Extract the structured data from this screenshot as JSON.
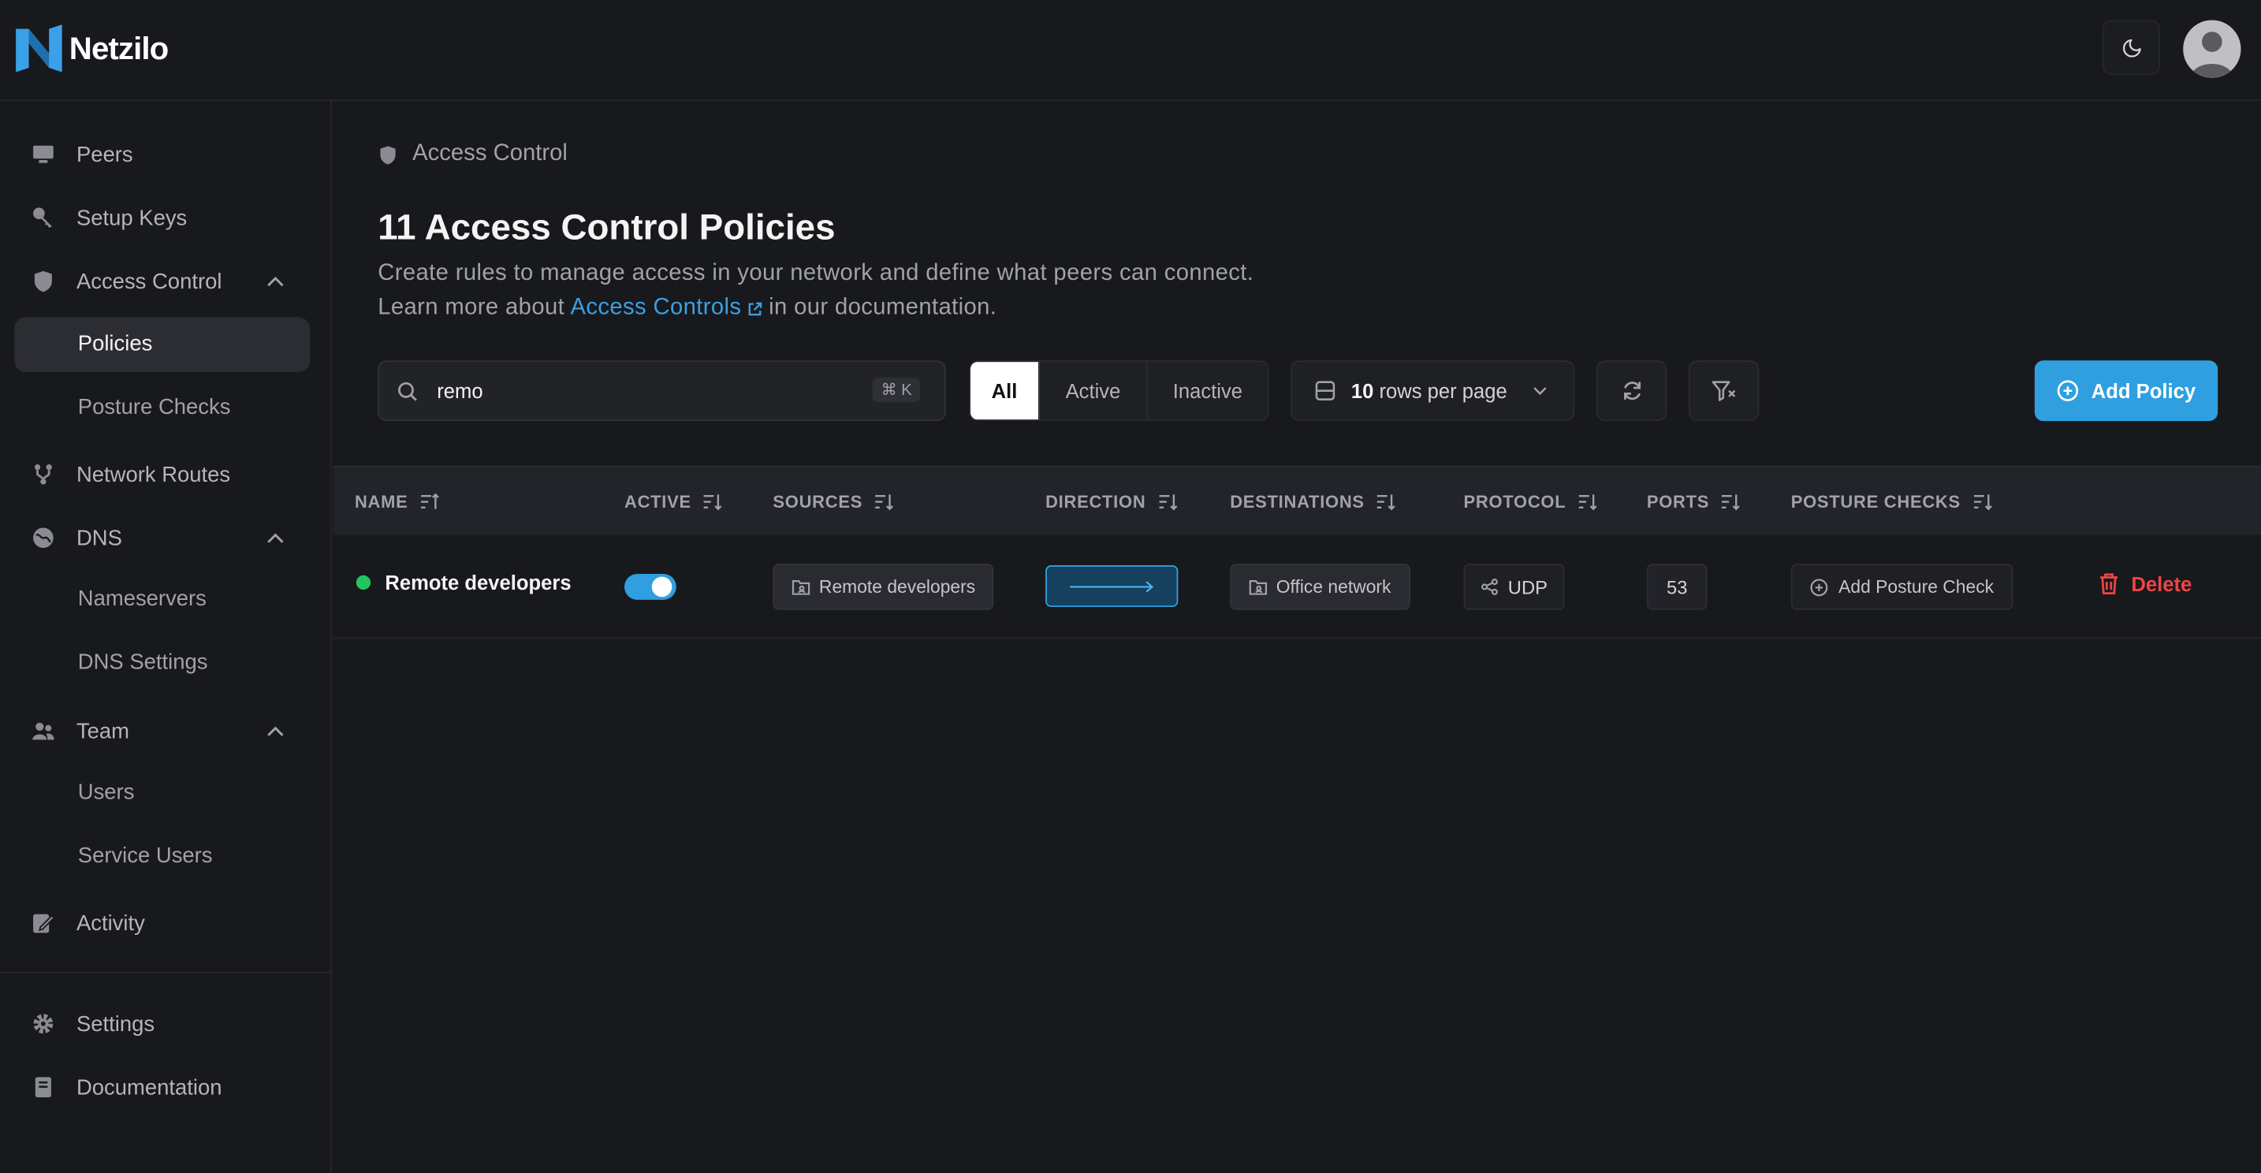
{
  "app": {
    "name": "Netzilo"
  },
  "sidebar": {
    "items": [
      {
        "label": "Peers"
      },
      {
        "label": "Setup Keys"
      },
      {
        "label": "Access Control"
      },
      {
        "label": "Policies"
      },
      {
        "label": "Posture Checks"
      },
      {
        "label": "Network Routes"
      },
      {
        "label": "DNS"
      },
      {
        "label": "Nameservers"
      },
      {
        "label": "DNS Settings"
      },
      {
        "label": "Team"
      },
      {
        "label": "Users"
      },
      {
        "label": "Service Users"
      },
      {
        "label": "Activity"
      },
      {
        "label": "Settings"
      },
      {
        "label": "Documentation"
      }
    ]
  },
  "breadcrumb": {
    "label": "Access Control"
  },
  "page": {
    "title": "11 Access Control Policies",
    "description_line1": "Create rules to manage access in your network and define what peers can connect.",
    "description_prefix": "Learn more about",
    "description_link": "Access Controls",
    "description_suffix": "in our documentation."
  },
  "search": {
    "value": "remo",
    "shortcut": "⌘ K"
  },
  "filters": {
    "all": "All",
    "active": "Active",
    "inactive": "Inactive",
    "selected": "All"
  },
  "pagination": {
    "rows_count": "10",
    "rows_label": "rows per page"
  },
  "actions": {
    "add_policy": "Add Policy"
  },
  "table": {
    "columns": [
      "NAME",
      "ACTIVE",
      "SOURCES",
      "DIRECTION",
      "DESTINATIONS",
      "PROTOCOL",
      "PORTS",
      "POSTURE CHECKS"
    ],
    "rows": [
      {
        "name": "Remote developers",
        "active": true,
        "source": "Remote developers",
        "direction": "→",
        "destination": "Office network",
        "protocol": "UDP",
        "ports": "53",
        "posture": "Add Posture Check",
        "delete": "Delete"
      }
    ]
  },
  "colors": {
    "accent": "#2f9fe0",
    "danger": "#ef4444",
    "status_active": "#22c55e",
    "background": "#18191c"
  }
}
